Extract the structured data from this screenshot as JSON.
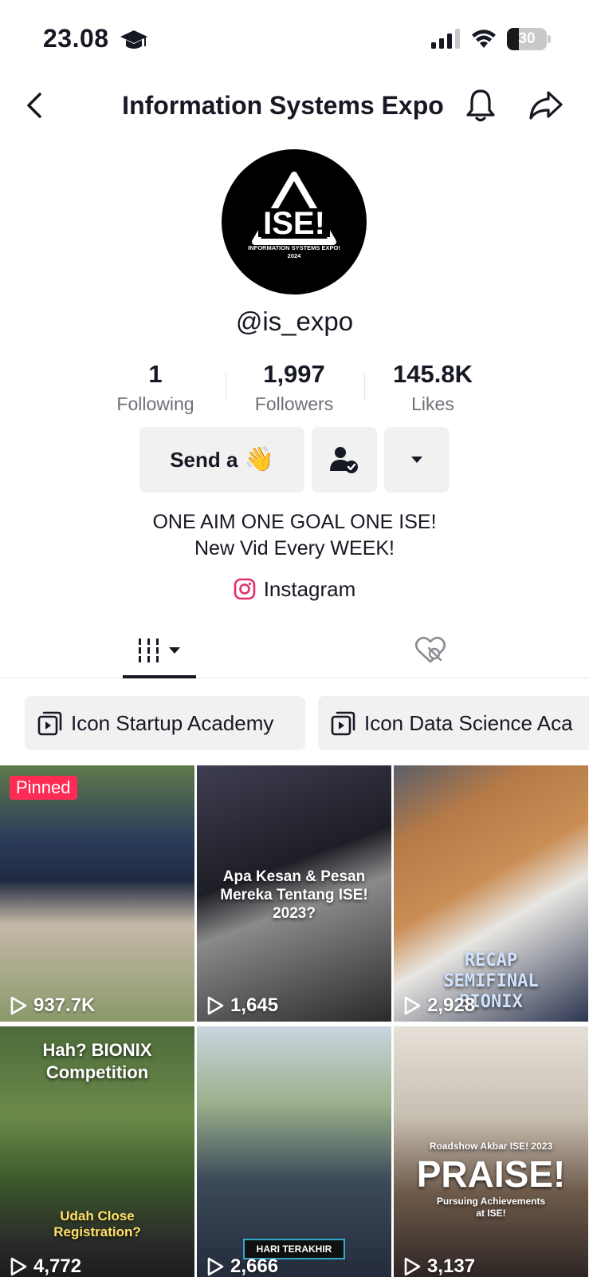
{
  "status_bar": {
    "time": "23.08",
    "battery": "30",
    "battery_level": 0.3
  },
  "header": {
    "title": "Information Systems Expo"
  },
  "profile": {
    "avatar_logo_text": "ISE!",
    "avatar_logo_subtitle": "INFORMATION SYSTEMS EXPO!",
    "avatar_logo_year": "2024",
    "username": "@is_expo",
    "stats": [
      {
        "value": "1",
        "label": "Following"
      },
      {
        "value": "1,997",
        "label": "Followers"
      },
      {
        "value": "145.8K",
        "label": "Likes"
      }
    ],
    "send_label": "Send a",
    "send_emoji": "👋",
    "bio_line1": "ONE AIM ONE GOAL ONE ISE!",
    "bio_line2": "New Vid Every WEEK!",
    "link_label": "Instagram"
  },
  "playlists": [
    {
      "label": "Icon Startup Academy"
    },
    {
      "label": "Icon Data Science Aca"
    }
  ],
  "videos": [
    {
      "views": "937.7K",
      "pinned": "Pinned",
      "caption": ""
    },
    {
      "views": "1,645",
      "caption": "Apa Kesan & Pesan Mereka Tentang ISE! 2023?"
    },
    {
      "views": "2,928",
      "caption": "RECAP SEMIFINAL BIONIX"
    },
    {
      "views": "4,772",
      "caption_top": "Hah? BIONIX Competition",
      "caption_bottom": "Udah Close Registration?"
    },
    {
      "views": "2,666",
      "caption": "HARI TERAKHIR"
    },
    {
      "views": "3,137",
      "caption_small": "Roadshow Akbar ISE! 2023",
      "caption_big": "PRAISE!",
      "caption_sub": "Pursuing Achievements at ISE!"
    }
  ],
  "colors": {
    "accent": "#fe2c55",
    "text": "#161823",
    "muted": "#6f7077",
    "chip_bg": "#f1f1f2"
  }
}
